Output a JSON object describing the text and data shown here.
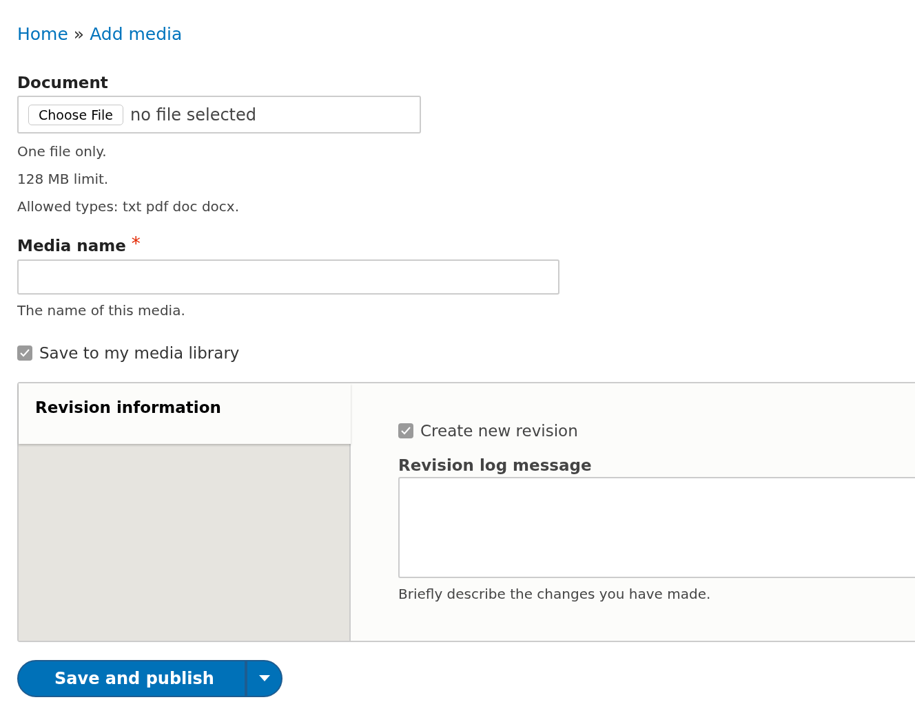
{
  "breadcrumb": {
    "items": [
      {
        "label": "Home"
      },
      {
        "label": "Add media"
      }
    ],
    "separator": "»"
  },
  "document": {
    "label": "Document",
    "button": "Choose File",
    "status": "no file selected",
    "descriptions": [
      "One file only.",
      "128 MB limit.",
      "Allowed types: txt pdf doc docx."
    ]
  },
  "media_name": {
    "label": "Media name",
    "required_mark": "*",
    "description": "The name of this media."
  },
  "save_to_library": {
    "label": "Save to my media library",
    "checked": true
  },
  "vertical_tabs": {
    "tabs": [
      {
        "label": "Revision information",
        "selected": true
      }
    ],
    "pane": {
      "create_revision": {
        "label": "Create new revision",
        "checked": true
      },
      "log_label": "Revision log message",
      "log_description": "Briefly describe the changes you have made."
    }
  },
  "actions": {
    "primary": "Save and publish"
  }
}
